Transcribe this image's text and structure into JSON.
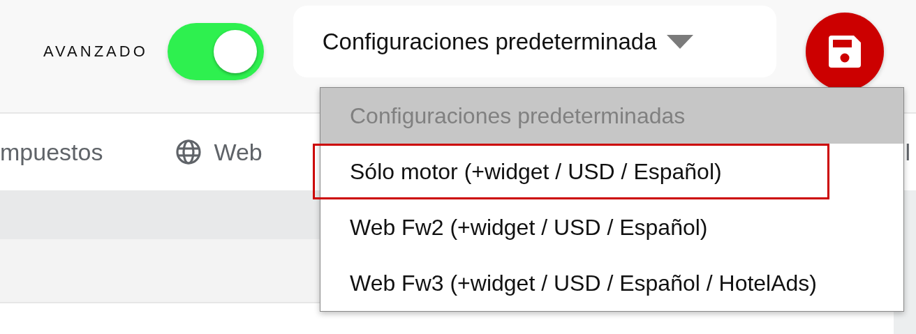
{
  "header": {
    "advanced": {
      "label": "AVANZADO",
      "on": true
    },
    "preset_select": {
      "value": "Configuraciones predeterminada"
    }
  },
  "tabs": [
    {
      "label": "mpuestos",
      "kind": "plain"
    },
    {
      "label": "Web",
      "kind": "globe"
    },
    {
      "label": "l",
      "kind": "plain"
    }
  ],
  "preset_options": [
    {
      "label": "Configuraciones predeterminadas",
      "disabled": true,
      "selected": false
    },
    {
      "label": "Sólo motor (+widget / USD / Español)",
      "disabled": false,
      "selected": true
    },
    {
      "label": "Web Fw2 (+widget / USD / Español)",
      "disabled": false,
      "selected": false
    },
    {
      "label": "Web Fw3 (+widget / USD / Español / HotelAds)",
      "disabled": false,
      "selected": false
    }
  ]
}
